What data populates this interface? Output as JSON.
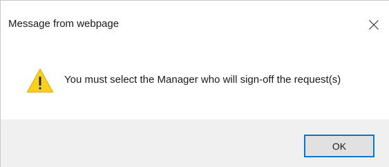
{
  "dialog": {
    "title": "Message from webpage",
    "message": "You must select the Manager who will sign-off the request(s)",
    "ok_label": "OK",
    "icons": {
      "close": "close-icon",
      "warning": "warning-icon"
    },
    "colors": {
      "accent_border": "#0078d7",
      "footer_bg": "#f0f0f0",
      "warning_fill": "#fcd116"
    }
  }
}
